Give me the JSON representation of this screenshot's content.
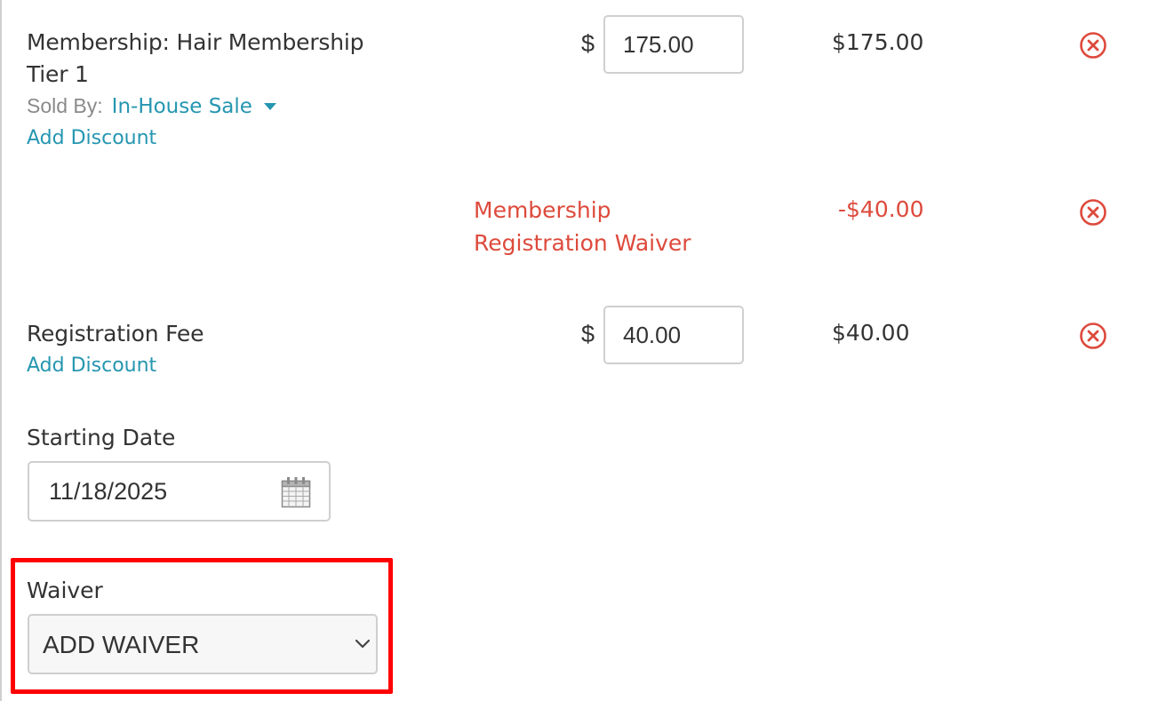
{
  "items": [
    {
      "name_line1": "Membership: Hair Membership",
      "name_line2": "Tier 1",
      "sold_by_label": "Sold By:",
      "sold_by_value": "In-House Sale",
      "add_discount": "Add Discount",
      "currency": "$",
      "price": "175.00",
      "total": "$175.00"
    },
    {
      "name": "Registration Fee",
      "add_discount": "Add Discount",
      "currency": "$",
      "price": "40.00",
      "total": "$40.00"
    }
  ],
  "discount": {
    "name_line1": "Membership",
    "name_line2": "Registration Waiver",
    "amount": "-$40.00"
  },
  "starting_date": {
    "label": "Starting Date",
    "value": "11/18/2025"
  },
  "waiver": {
    "label": "Waiver",
    "selected": "ADD WAIVER"
  },
  "colors": {
    "link": "#2596b0",
    "danger": "#dd4a3c",
    "highlight": "#ff0000",
    "border": "#cfcfcf"
  },
  "icons": {
    "remove": "close-circle-icon",
    "dropdown": "caret-down-icon",
    "calendar": "calendar-icon",
    "select": "chevron-down-icon"
  }
}
